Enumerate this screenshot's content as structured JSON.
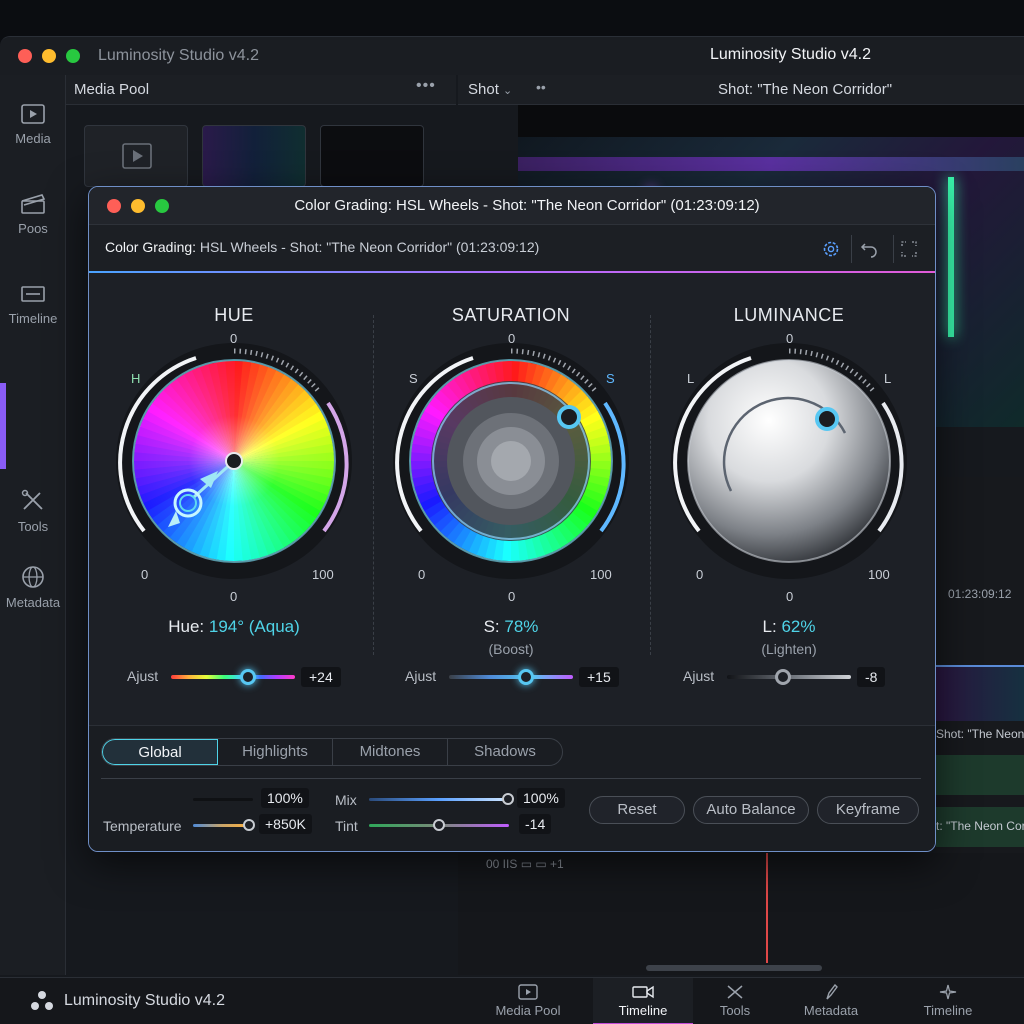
{
  "app": {
    "title_left": "Luminosity Studio v4.2",
    "title_center": "Luminosity Studio v4.2"
  },
  "sidebar": {
    "items": [
      {
        "label": "Media",
        "icon": "media-icon"
      },
      {
        "label": "Poos",
        "icon": "clapper-icon"
      },
      {
        "label": "Timeline",
        "icon": "timeline-icon"
      },
      {
        "label": "Tools",
        "icon": "tools-icon"
      },
      {
        "label": "Metadata",
        "icon": "globe-icon"
      }
    ],
    "accent_color": "#8a5cf6"
  },
  "media_pool": {
    "title": "Media Pool",
    "menu": "•••"
  },
  "viewer": {
    "dropdown": "Shot",
    "menu": "••",
    "title": "Shot: \"The Neon Corridor\""
  },
  "timeline": {
    "timecode": "01:23:09:12",
    "clip_label": "Shot: \"The Neon C",
    "clip_label_2": "t: \"The Neon Cor",
    "controls": "00     IIS     ▭     ▭     +1"
  },
  "dialog": {
    "title": "Color Grading: HSL Wheels - Shot: \"The Neon Corridor\" (01:23:09:12)",
    "sub_strong": "Color Grading:",
    "sub_rest": " HSL Wheels - Shot: \"The Neon Corridor\" (01:23:09:12)",
    "hue": {
      "title": "HUE",
      "top": "0",
      "letter": "H",
      "min": "0",
      "max": "100",
      "bottom": "0",
      "value_prefix": "Hue: ",
      "value": "194° (Aqua)",
      "adjust_label": "Ajust",
      "adjust_value": "+24",
      "adjust_fraction": 0.62
    },
    "saturation": {
      "title": "SATURATION",
      "top": "0",
      "letter_left": "S",
      "letter_right": "S",
      "min": "0",
      "max": "100",
      "bottom": "0",
      "value_prefix": "S: ",
      "value": "78%",
      "sub": "(Boost)",
      "adjust_label": "Ajust",
      "adjust_value": "+15",
      "adjust_fraction": 0.62
    },
    "luminance": {
      "title": "LUMINANCE",
      "top": "0",
      "letter_left": "L",
      "letter_right": "L",
      "min": "0",
      "max": "100",
      "bottom": "0",
      "value_prefix": "L: ",
      "value": "62%",
      "sub": "(Lighten)",
      "adjust_label": "Ajust",
      "adjust_value": "-8",
      "adjust_fraction": 0.45
    },
    "tabs": [
      "Global",
      "Highlights",
      "Midtones",
      "Shadows"
    ],
    "active_tab": "Global",
    "controls": {
      "unnamed_value": "100%",
      "temperature_label": "Temperature",
      "temperature_value": "+850K",
      "mix_label": "Mix",
      "mix_value": "100%",
      "tint_label": "Tint",
      "tint_value": "-14"
    },
    "buttons": {
      "reset": "Reset",
      "auto_balance": "Auto Balance",
      "keyframe": "Keyframe"
    }
  },
  "bottom_bar": {
    "brand": "Luminosity Studio v4.2",
    "tabs": [
      {
        "label": "Media Pool",
        "icon": "media-icon"
      },
      {
        "label": "Timeline",
        "icon": "camera-icon",
        "active": true
      },
      {
        "label": "Tools",
        "icon": "tools-icon"
      },
      {
        "label": "Metadata",
        "icon": "pen-icon"
      },
      {
        "label": "Timeline",
        "icon": "sparkle-icon"
      }
    ],
    "active_color": "#c24bd8"
  }
}
